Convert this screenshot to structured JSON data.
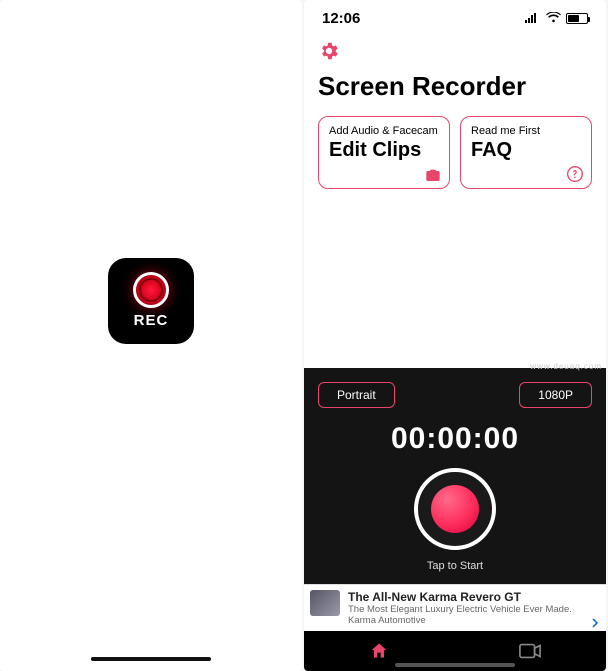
{
  "left": {
    "icon_label": "REC"
  },
  "status": {
    "time": "12:06"
  },
  "header": {
    "title": "Screen Recorder"
  },
  "cards": [
    {
      "subtitle": "Add Audio & Facecam",
      "title": "Edit Clips",
      "icon": "camera"
    },
    {
      "subtitle": "Read me First",
      "title": "FAQ",
      "icon": "help"
    }
  ],
  "recorder": {
    "mode_label": "Portrait",
    "quality_label": "1080P",
    "timer": "00:00:00",
    "caption": "Tap to Start"
  },
  "ad": {
    "title": "The All-New Karma Revero GT",
    "subtitle": "The Most Elegant Luxury Electric Vehicle Ever Made. Karma Automotive"
  },
  "colors": {
    "accent": "#e9456a"
  },
  "watermark": "www.deuaq.com"
}
